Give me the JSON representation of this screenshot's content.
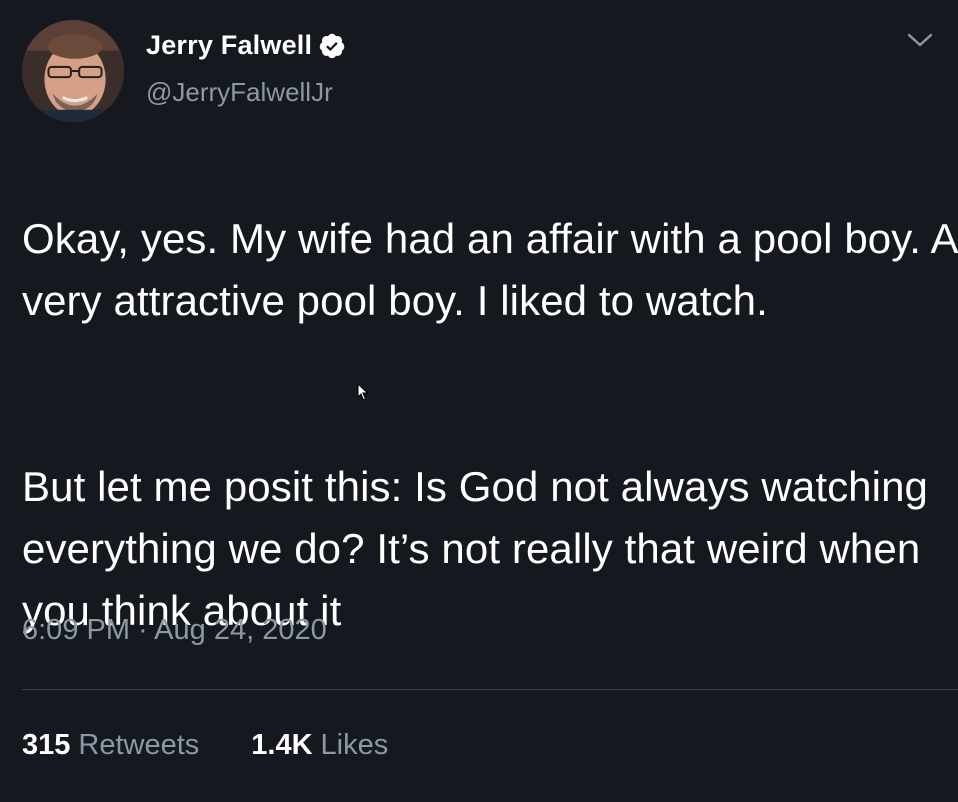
{
  "tweet": {
    "author": {
      "display_name": "Jerry Falwell",
      "handle": "@JerryFalwellJr",
      "verified": true
    },
    "paragraphs": [
      "Okay, yes. My wife had an affair with a pool boy. A very attractive pool boy. I liked to watch.",
      "But let me posit this: Is God not always watching everything we do? It’s not really that weird when you think about it"
    ],
    "timestamp": "6:09 PM · Aug 24, 2020",
    "stats": {
      "retweets_count": "315",
      "retweets_label": "Retweets",
      "likes_count": "1.4K",
      "likes_label": "Likes"
    }
  },
  "icons": {
    "verified": "verified-badge-icon",
    "menu": "chevron-down-icon",
    "cursor": "mouse-cursor-icon"
  },
  "colors": {
    "background": "#15181f",
    "text_primary": "#ffffff",
    "text_secondary": "#8b98a5",
    "divider": "#38444d"
  }
}
